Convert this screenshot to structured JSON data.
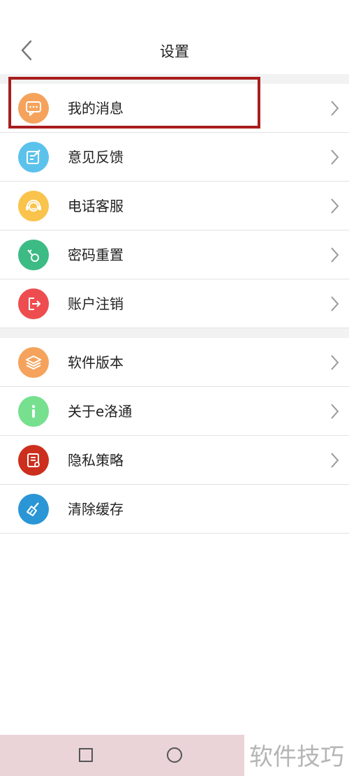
{
  "header": {
    "title": "设置",
    "back_icon": "chevron-left-icon"
  },
  "group1": [
    {
      "label": "我的消息",
      "icon": "chat-bubble-icon",
      "color": "#f5a35c",
      "chevron": true
    },
    {
      "label": "意见反馈",
      "icon": "edit-note-icon",
      "color": "#5bc2ec",
      "chevron": true
    },
    {
      "label": "电话客服",
      "icon": "headset-agent-icon",
      "color": "#f9c34c",
      "chevron": true
    },
    {
      "label": "密码重置",
      "icon": "key-icon",
      "color": "#3dbb85",
      "chevron": true
    },
    {
      "label": "账户注销",
      "icon": "logout-icon",
      "color": "#ee4d50",
      "chevron": true
    }
  ],
  "group2": [
    {
      "label": "软件版本",
      "icon": "layers-icon",
      "color": "#f5a35c",
      "chevron": true
    },
    {
      "label": "关于e洛通",
      "icon": "info-icon",
      "color": "#76e08f",
      "chevron": true
    },
    {
      "label": "隐私策略",
      "icon": "certificate-icon",
      "color": "#cc2f1d",
      "chevron": true
    },
    {
      "label": "清除缓存",
      "icon": "broom-icon",
      "color": "#2a96d6",
      "chevron": false
    }
  ],
  "highlight_color": "#a81e1e",
  "navbar": {
    "square_icon": "recents-square-icon",
    "circle_icon": "home-circle-icon"
  },
  "watermark": "软件技巧"
}
